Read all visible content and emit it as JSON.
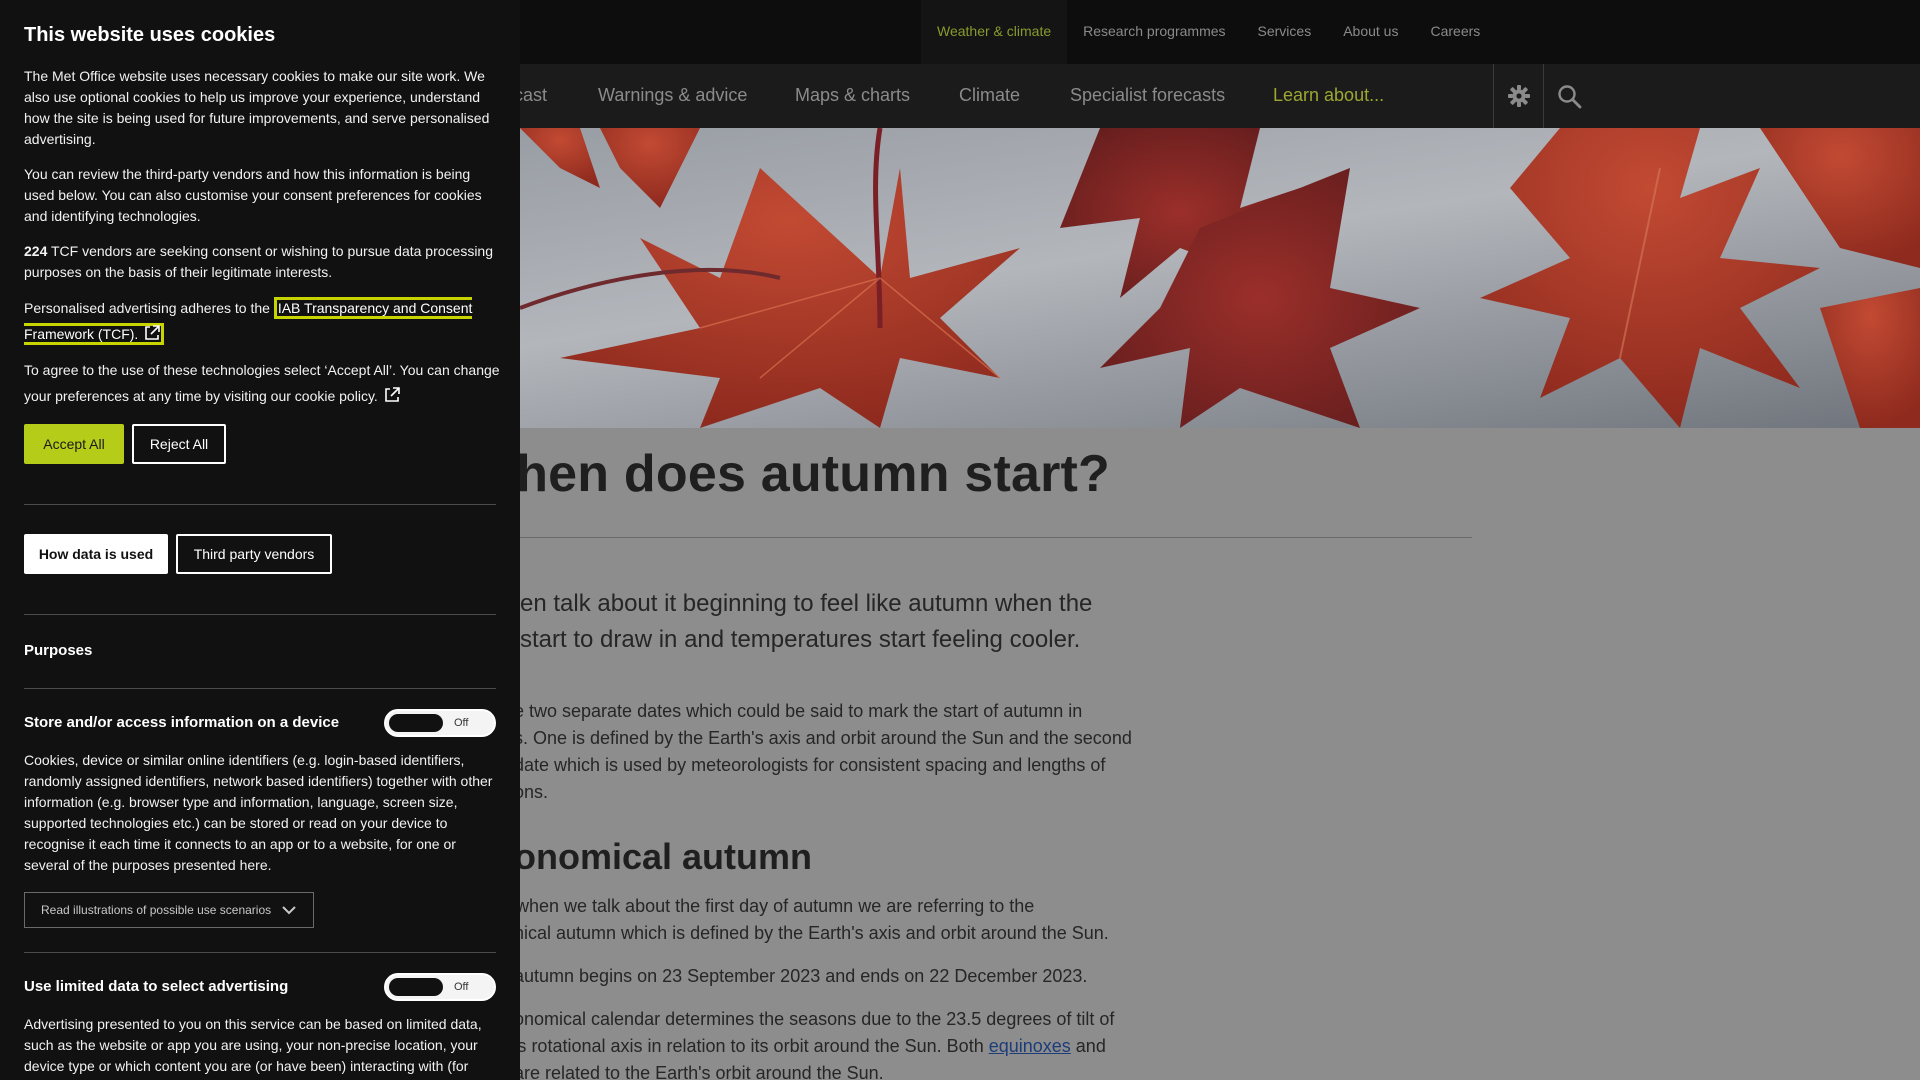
{
  "site": {
    "util_nav": [
      {
        "label": "Weather & climate",
        "active": true
      },
      {
        "label": "Research programmes",
        "active": false
      },
      {
        "label": "Services",
        "active": false
      },
      {
        "label": "About us",
        "active": false
      },
      {
        "label": "Careers",
        "active": false
      }
    ],
    "main_nav": [
      {
        "label": "cast"
      },
      {
        "label": "Warnings & advice"
      },
      {
        "label": "Maps & charts"
      },
      {
        "label": "Climate"
      },
      {
        "label": "Specialist forecasts"
      },
      {
        "label": "Learn about..."
      }
    ],
    "icons": {
      "settings": "gear-icon",
      "search": "search-icon"
    },
    "colors": {
      "accent": "#9da732",
      "link": "#1d3d7a",
      "cookie_accept": "#b5cd19"
    }
  },
  "article": {
    "title": "hen does autumn start?",
    "lead_lines": [
      "en talk about it beginning to feel like autumn when the",
      "start to draw in and temperatures start feeling cooler."
    ],
    "intro_lines": [
      "e two separate dates which could be said to mark the start of autumn in",
      "s. One is defined by the Earth's axis and orbit around the Sun and the second",
      " date which is used by meteorologists for consistent spacing and lengths of",
      "ons."
    ],
    "h2": "onomical autumn",
    "astro_lines": [
      "when we talk about the first day of autumn we are referring to the",
      "nical autumn which is defined by the Earth's axis and orbit around the Sun."
    ],
    "dates_line": " autumn begins on 23 September 2023 and ends on 22 December 2023.",
    "calendar_line1": "onomical calendar determines the seasons due to the 23.5 degrees of tilt of",
    "calendar_line2_pre": "'s rotational axis in relation to its orbit around the Sun. Both ",
    "calendar_link": "equinoxes",
    "calendar_line2_post": " and",
    "calendar_line3": "are related to the Earth's orbit around the Sun."
  },
  "cookie": {
    "title": "This website uses cookies",
    "p1": "The Met Office website uses necessary cookies to make our site work. We also use optional cookies to help us improve your experience, understand how the site is being used for future improvements, and serve personalised advertising.",
    "p2": "You can review the third-party vendors and how this information is being used below. You can also customise your consent preferences for cookies and identifying technologies.",
    "vendor_count": "224",
    "p3_rest": " TCF vendors are seeking consent or wishing to pursue data processing purposes on the basis of their legitimate interests.",
    "p4_pre": "Personalised advertising adheres to the ",
    "p4_link": "IAB Transparency and Consent Framework (TCF).",
    "p5": "To agree to the use of these technologies select ‘Accept All’. You can change your preferences at any time by visiting our cookie policy.",
    "accept": "Accept All",
    "reject": "Reject All",
    "how_data": "How data is used",
    "third_party": "Third party vendors",
    "purposes": "Purposes",
    "purpose1": {
      "title": "Store and/or access information on a device",
      "toggle": "Off",
      "desc": "Cookies, device or similar online identifiers (e.g. login-based identifiers, randomly assigned identifiers, network based identifiers) together with other information (e.g. browser type and information, language, screen size, supported technologies etc.) can be stored or read on your device to recognise it each time it connects to an app or to a website, for one or several of the purposes presented here.",
      "scenarios": "Read illustrations of possible use scenarios"
    },
    "purpose2": {
      "title": "Use limited data to select advertising",
      "toggle": "Off",
      "desc": "Advertising presented to you on this service can be based on limited data, such as the website or app you are using, your non-precise location, your device type or which content you are (or have been) interacting with (for"
    }
  }
}
